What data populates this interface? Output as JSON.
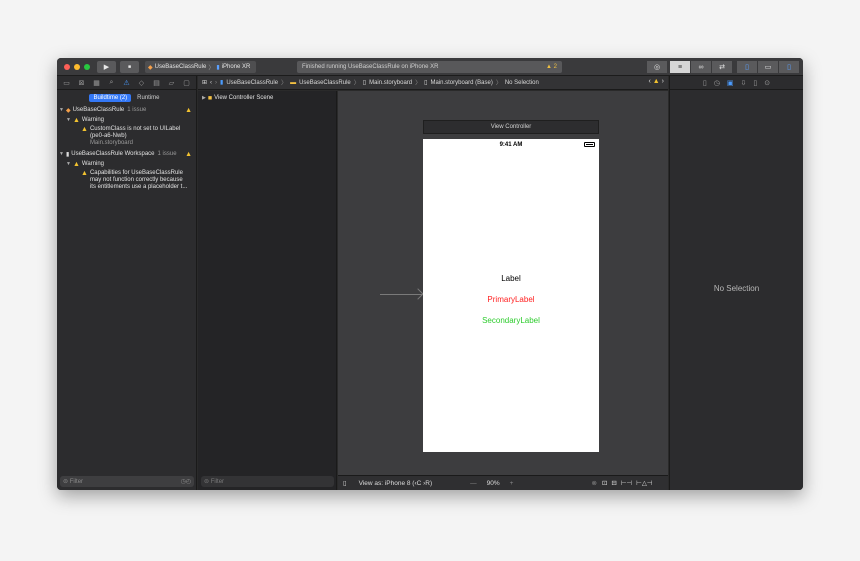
{
  "toolbar": {
    "scheme_name": "UseBaseClassRule",
    "device_name": "iPhone XR",
    "status_text": "Finished running UseBaseClassRule on iPhone XR",
    "warning_count": "2",
    "play_icon": "▶",
    "stop_icon": "■"
  },
  "navigator": {
    "tabs": [
      "Buildtime (2)",
      "Runtime"
    ],
    "issues": [
      {
        "project": "UseBaseClassRule",
        "count": "1 issue",
        "group": "Warning",
        "message_lines": [
          "CustomClass is not set to UILabel",
          "(pe0-a6-Nwb)"
        ],
        "file": "Main.storyboard"
      },
      {
        "project": "UseBaseClassRule Workspace",
        "count": "1 issue",
        "group": "Warning",
        "message_lines": [
          "Capabilities for UseBaseClassRule",
          "may not function correctly because",
          "its entitlements use a placeholder t..."
        ]
      }
    ],
    "filter_placeholder": "Filter"
  },
  "jumpbar": {
    "items": [
      "UseBaseClassRule",
      "UseBaseClassRule",
      "Main.storyboard",
      "Main.storyboard (Base)",
      "No Selection"
    ]
  },
  "outline": {
    "scene": "View Controller Scene",
    "filter_placeholder": "Filter"
  },
  "canvas": {
    "vc_title": "View Controller",
    "time": "9:41 AM",
    "labels": [
      {
        "text": "Label",
        "color": "#000000"
      },
      {
        "text": "PrimaryLabel",
        "color": "#ff2020"
      },
      {
        "text": "SecondaryLabel",
        "color": "#2ecc2e"
      }
    ],
    "view_as": "View as: iPhone 8 (‹C ›R)",
    "zoom": "90%",
    "zoom_out": "—",
    "zoom_in": "+"
  },
  "inspector": {
    "empty_text": "No Selection"
  }
}
